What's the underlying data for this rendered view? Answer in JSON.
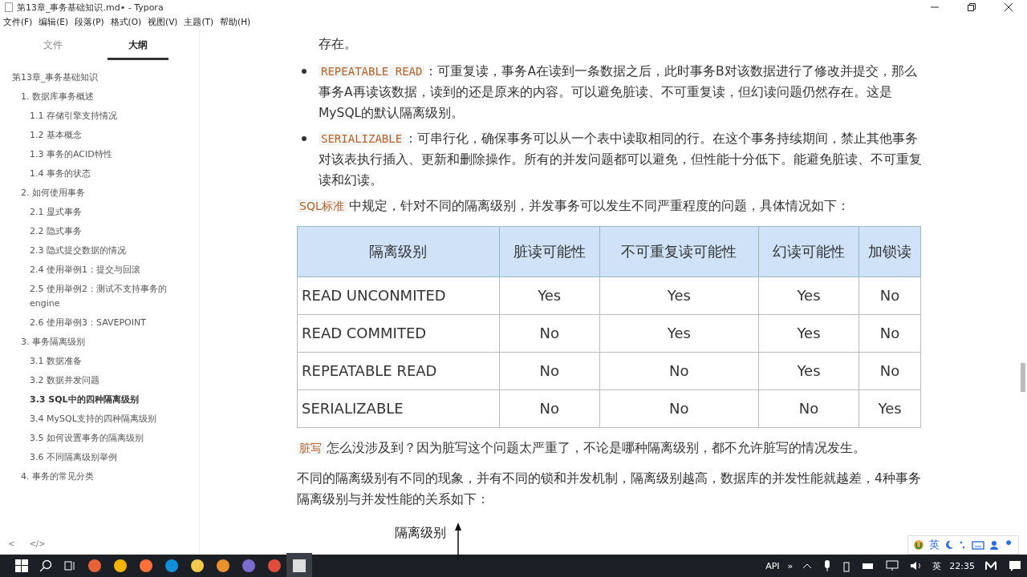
{
  "window": {
    "title": "第13章_事务基础知识.md• - Typora"
  },
  "menu": [
    "文件(F)",
    "编辑(E)",
    "段落(P)",
    "格式(O)",
    "视图(V)",
    "主题(T)",
    "帮助(H)"
  ],
  "sidebar": {
    "tabs": [
      {
        "label": "文件",
        "selected": false
      },
      {
        "label": "大纲",
        "selected": true
      }
    ],
    "outline": [
      {
        "label": "第13章_事务基础知识",
        "selected": false,
        "children": [
          {
            "label": "1. 数据库事务概述",
            "selected": false,
            "children": [
              {
                "label": "1.1 存储引擎支持情况",
                "selected": false
              },
              {
                "label": "1.2 基本概念",
                "selected": false
              },
              {
                "label": "1.3 事务的ACID特性",
                "selected": false
              },
              {
                "label": "1.4 事务的状态",
                "selected": false
              }
            ]
          },
          {
            "label": "2. 如何使用事务",
            "selected": false,
            "children": [
              {
                "label": "2.1 显式事务",
                "selected": false
              },
              {
                "label": "2.2 隐式事务",
                "selected": false
              },
              {
                "label": "2.3 隐式提交数据的情况",
                "selected": false
              },
              {
                "label": "2.4 使用举例1：提交与回滚",
                "selected": false
              },
              {
                "label": "2.5 使用举例2：测试不支持事务的engine",
                "selected": false
              },
              {
                "label": "2.6 使用举例3：SAVEPOINT",
                "selected": false
              }
            ]
          },
          {
            "label": "3. 事务隔离级别",
            "selected": false,
            "children": [
              {
                "label": "3.1 数据准备",
                "selected": false
              },
              {
                "label": "3.2 数据并发问题",
                "selected": false
              },
              {
                "label": "3.3 SQL中的四种隔离级别",
                "selected": true
              },
              {
                "label": "3.4 MySQL支持的四种隔离级别",
                "selected": false
              },
              {
                "label": "3.5 如何设置事务的隔离级别",
                "selected": false
              },
              {
                "label": "3.6 不同隔离级别举例",
                "selected": false
              }
            ]
          },
          {
            "label": "4. 事务的常见分类",
            "selected": false
          }
        ]
      }
    ],
    "footer": [
      "<",
      "</>"
    ]
  },
  "content": {
    "blocks": [
      {
        "kind": "tail",
        "text": "存在。"
      },
      {
        "kind": "bullet",
        "code": "REPEATABLE READ",
        "text": "：可重复读，事务A在读到一条数据之后，此时事务B对该数据进行了修改并提交，那么事务A再读该数据，读到的还是原来的内容。可以避免脏读、不可重复读，但幻读问题仍然存在。这是MySQL的默认隔离级别。"
      },
      {
        "kind": "bullet",
        "code": "SERIALIZABLE",
        "text": "：可串行化，确保事务可以从一个表中读取相同的行。在这个事务持续期间，禁止其他事务对该表执行插入、更新和删除操作。所有的并发问题都可以避免，但性能十分低下。能避免脏读、不可重复读和幻读。"
      },
      {
        "kind": "para",
        "code": "SQL标准",
        "text": "中规定，针对不同的隔离级别，并发事务可以发生不同严重程度的问题，具体情况如下："
      },
      {
        "kind": "table",
        "columns": [
          "隔离级别",
          "脏读可能性",
          "不可重复读可能性",
          "幻读可能性",
          "加锁读"
        ],
        "rows": [
          [
            "READ UNCONMITED",
            "Yes",
            "Yes",
            "Yes",
            "No"
          ],
          [
            "READ COMMITED",
            "No",
            "Yes",
            "Yes",
            "No"
          ],
          [
            "REPEATABLE READ",
            "No",
            "No",
            "Yes",
            "No"
          ],
          [
            "SERIALIZABLE",
            "No",
            "No",
            "No",
            "Yes"
          ]
        ]
      },
      {
        "kind": "para",
        "code": "脏写",
        "text": "怎么没涉及到？因为脏写这个问题太严重了，不论是哪种隔离级别，都不允许脏写的情况发生。"
      },
      {
        "kind": "para",
        "text": "不同的隔离级别有不同的现象，并有不同的锁和并发机制，隔离级别越高，数据库的并发性能就越差，4种事务隔离级别与并发性能的关系如下："
      },
      {
        "kind": "figure",
        "text": "隔离级别"
      }
    ]
  },
  "ime": {
    "label": "英"
  },
  "taskbar": {
    "tray": [
      "API",
      "»",
      "英"
    ],
    "time": "22:35"
  }
}
